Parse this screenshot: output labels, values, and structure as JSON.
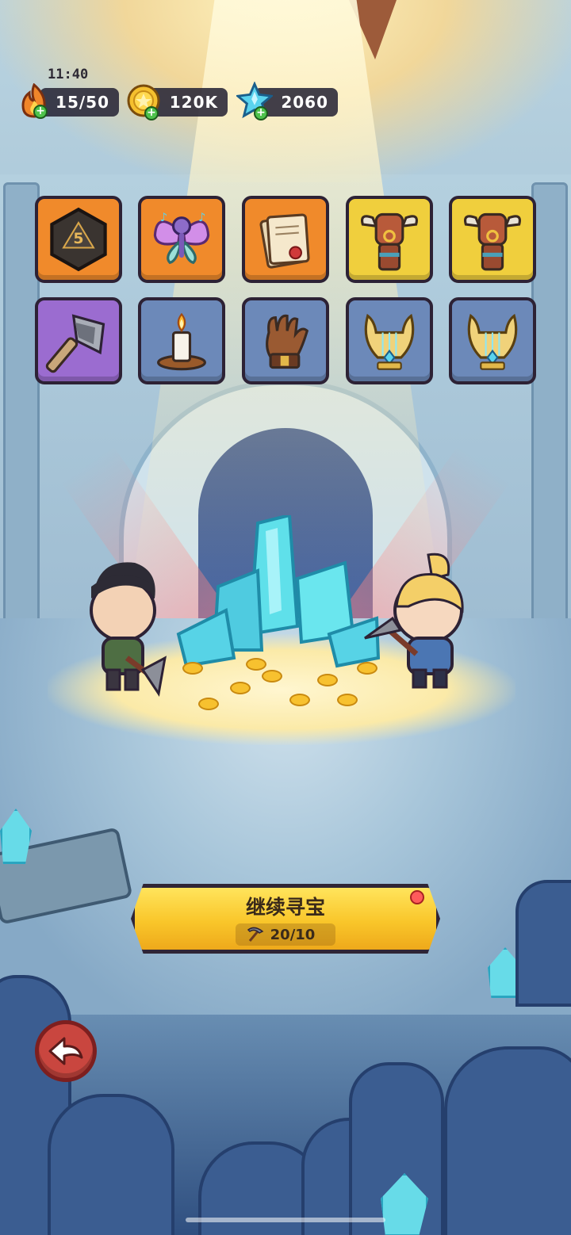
{
  "status_bar": {
    "time": "11:40"
  },
  "currencies": [
    {
      "id": "energy",
      "icon": "flame-icon",
      "value": "15/50",
      "color": "#f0862a"
    },
    {
      "id": "coins",
      "icon": "gold-coin-icon",
      "value": "120K",
      "color": "#f5c02e"
    },
    {
      "id": "gems",
      "icon": "blue-crystal-icon",
      "value": "2060",
      "color": "#5ad3ee"
    }
  ],
  "items": [
    {
      "name": "d20-dice-icon",
      "rarity": "orange"
    },
    {
      "name": "music-fairy-icon",
      "rarity": "orange"
    },
    {
      "name": "scroll-letter-icon",
      "rarity": "orange"
    },
    {
      "name": "bull-totem-icon",
      "rarity": "gold"
    },
    {
      "name": "bull-totem-icon",
      "rarity": "gold"
    },
    {
      "name": "battle-axe-icon",
      "rarity": "purple"
    },
    {
      "name": "candle-icon",
      "rarity": "blue"
    },
    {
      "name": "leather-glove-icon",
      "rarity": "blue"
    },
    {
      "name": "golden-lyre-icon",
      "rarity": "blue"
    },
    {
      "name": "golden-lyre-icon",
      "rarity": "blue"
    }
  ],
  "action_button": {
    "label": "继续寻宝",
    "cost_icon": "pickaxe-icon",
    "cost": "20/10"
  },
  "back_button": {
    "icon": "back-arrow-icon"
  },
  "colors": {
    "button_gold": "#f9c62a",
    "frame_dark": "#2d2235",
    "back_red": "#c9463f"
  }
}
